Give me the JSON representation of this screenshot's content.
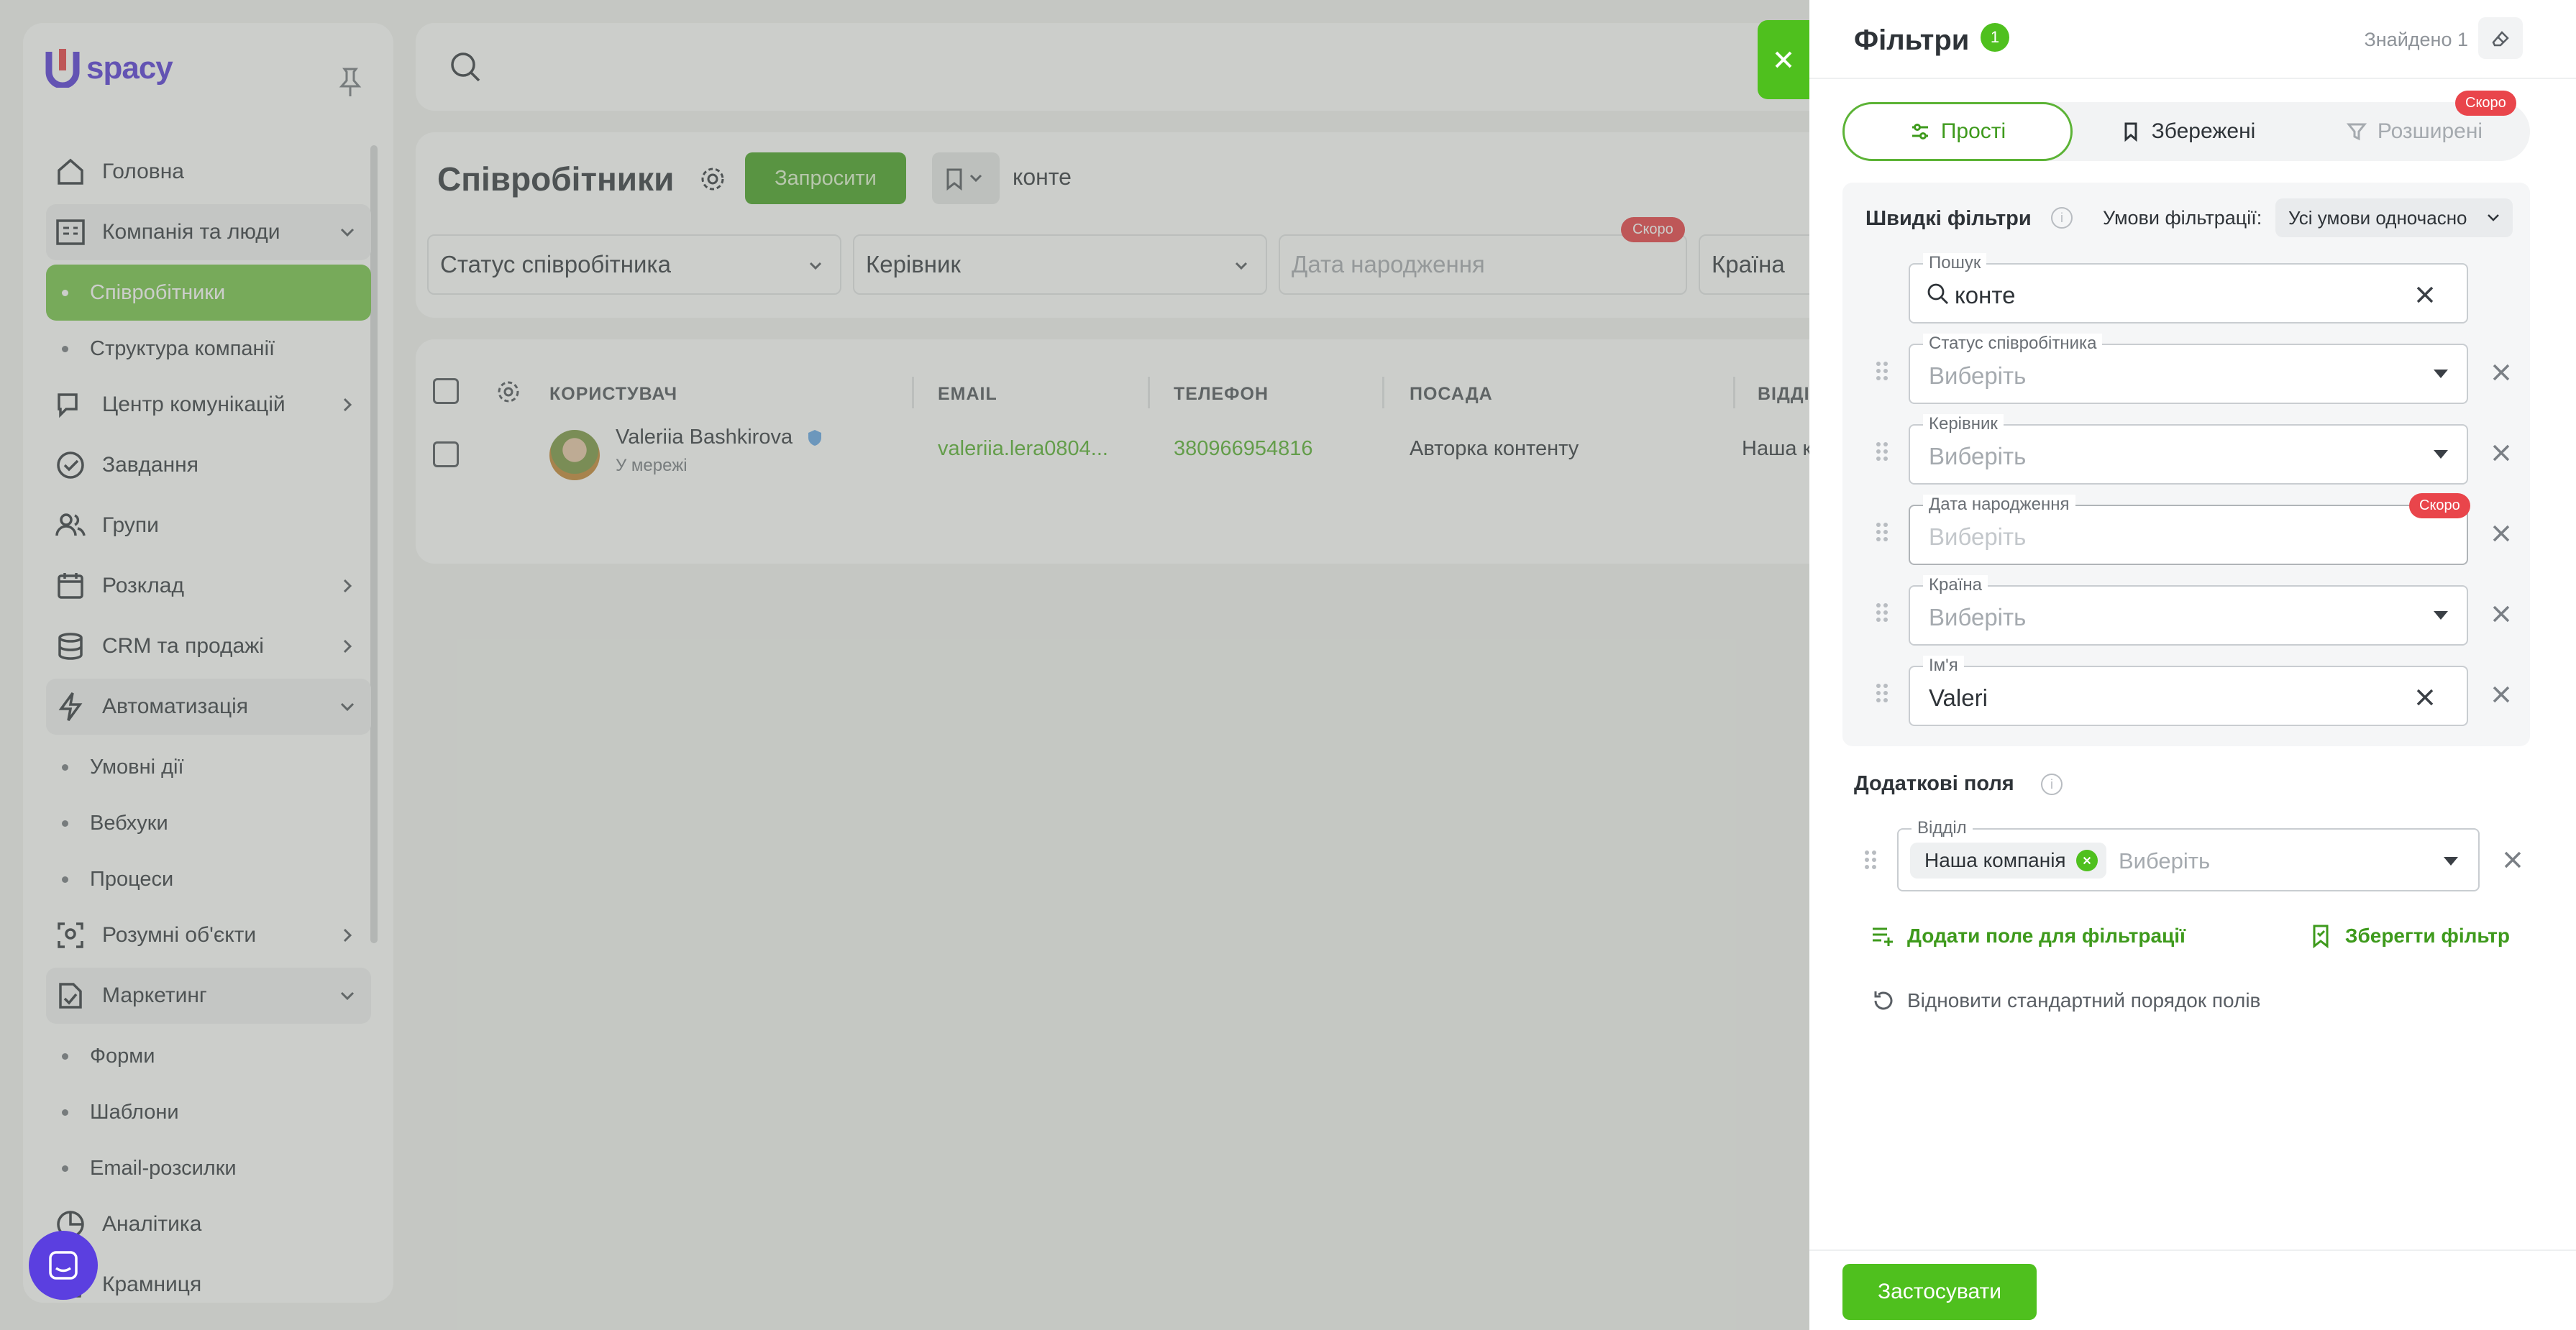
{
  "sidebar": {
    "logo": "spacy",
    "items": [
      {
        "label": "Головна",
        "icon": "home-icon"
      },
      {
        "label": "Компанія та люди",
        "icon": "company-icon"
      },
      {
        "label": "Співробітники"
      },
      {
        "label": "Структура компанії"
      },
      {
        "label": "Центр комунікацій",
        "icon": "chat-icon"
      },
      {
        "label": "Завдання",
        "icon": "check-icon"
      },
      {
        "label": "Групи",
        "icon": "users-icon"
      },
      {
        "label": "Розклад",
        "icon": "calendar-icon"
      },
      {
        "label": "CRM та продажі",
        "icon": "database-icon"
      },
      {
        "label": "Автоматизація",
        "icon": "lightning-icon"
      },
      {
        "label": "Умовні дії"
      },
      {
        "label": "Вебхуки"
      },
      {
        "label": "Процеси"
      },
      {
        "label": "Розумні об'єкти",
        "icon": "smart-object-icon"
      },
      {
        "label": "Маркетинг",
        "icon": "marketing-icon"
      },
      {
        "label": "Форми"
      },
      {
        "label": "Шаблони"
      },
      {
        "label": "Email-розсилки"
      },
      {
        "label": "Аналітика",
        "icon": "analytics-icon"
      },
      {
        "label": "Крамниця",
        "icon": "shop-icon"
      }
    ]
  },
  "page": {
    "title": "Співробітники",
    "invite_label": "Запросити",
    "search_value": "конте",
    "filters": [
      "Статус співробітника",
      "Керівник",
      "Дата народження",
      "Країна"
    ],
    "soon": "Скоро"
  },
  "table": {
    "headers": [
      "КОРИСТУВАЧ",
      "EMAIL",
      "ТЕЛЕФОН",
      "ПОСАДА",
      "ВІДДІ"
    ],
    "row": {
      "name": "Valeriia Bashkirova",
      "status": "У мережі",
      "email": "valeriia.lera0804...",
      "phone": "380966954816",
      "position": "Авторка контенту",
      "department": "Наша к"
    }
  },
  "drawer": {
    "title": "Фільтри",
    "count": "1",
    "found": "Знайдено 1",
    "tabs": {
      "simple": "Прості",
      "saved": "Збережені",
      "advanced": "Розширені",
      "soon": "Скоро"
    },
    "quick": {
      "title": "Швидкі фільтри",
      "cond_label": "Умови фільтрації:",
      "cond_value": "Усі умови одночасно",
      "fields": {
        "search": {
          "label": "Пошук",
          "value": "конте"
        },
        "status": {
          "label": "Статус співробітника",
          "placeholder": "Виберіть"
        },
        "manager": {
          "label": "Керівник",
          "placeholder": "Виберіть"
        },
        "birth": {
          "label": "Дата народження",
          "placeholder": "Виберіть",
          "soon": "Скоро"
        },
        "country": {
          "label": "Країна",
          "placeholder": "Виберіть"
        },
        "name": {
          "label": "Ім'я",
          "value": "Valeri"
        }
      }
    },
    "extra": {
      "title": "Додаткові поля",
      "dept": {
        "label": "Відділ",
        "chip": "Наша компанія",
        "placeholder": "Виберіть"
      }
    },
    "add_field": "Додати поле для фільтрації",
    "save_filter": "Зберегти фільтр",
    "reset_order": "Відновити стандартний порядок полів",
    "apply": "Застосувати"
  },
  "colors": {
    "accent": "#4fc01e",
    "brand": "#5b3fd9",
    "danger": "#e9454b"
  }
}
